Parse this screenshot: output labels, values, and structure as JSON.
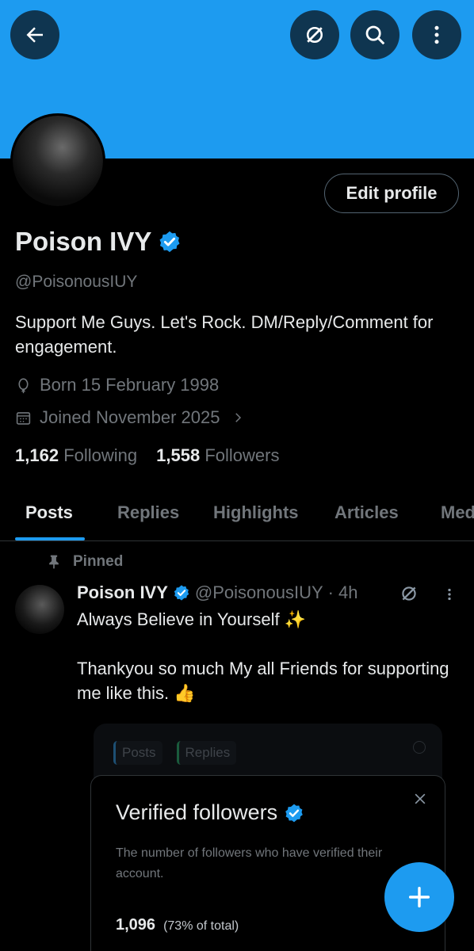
{
  "header": {
    "back_icon": "arrow-left-icon",
    "grok_icon": "grok-icon",
    "search_icon": "search-icon",
    "more_icon": "more-vertical-icon"
  },
  "profile": {
    "display_name": "Poison IVY",
    "handle": "@PoisonousIUY",
    "bio": "Support Me Guys. Let's Rock. DM/Reply/Comment for engagement.",
    "born": "Born 15 February 1998",
    "joined": "Joined November 2025",
    "following_count": "1,162",
    "following_label": "Following",
    "followers_count": "1,558",
    "followers_label": "Followers",
    "edit_button": "Edit profile",
    "verified": true
  },
  "tabs": [
    {
      "label": "Posts",
      "active": true
    },
    {
      "label": "Replies",
      "active": false
    },
    {
      "label": "Highlights",
      "active": false
    },
    {
      "label": "Articles",
      "active": false
    },
    {
      "label": "Media",
      "active": false
    }
  ],
  "post": {
    "pinned_label": "Pinned",
    "author_name": "Poison IVY",
    "author_handle": "@PoisonousIUY",
    "separator": "·",
    "time": "4h",
    "line1": "Always Believe in Yourself ✨",
    "line2": "Thankyou so much My all Friends for supporting me like this. 👍"
  },
  "media": {
    "tab_posts": "Posts",
    "tab_replies": "Replies",
    "card_title": "Verified followers",
    "card_desc": "The number of followers who have verified their account.",
    "count": "1,096",
    "percent": "(73% of total)"
  },
  "colors": {
    "accent": "#1d9bf0",
    "background": "#000000",
    "muted": "#71767b"
  }
}
